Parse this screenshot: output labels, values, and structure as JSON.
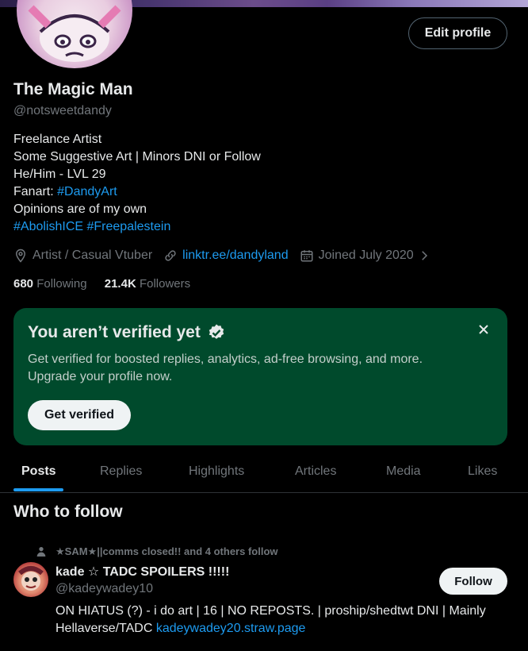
{
  "profile": {
    "edit_label": "Edit profile",
    "name": "The Magic Man",
    "handle": "@notsweetdandy",
    "bio": {
      "line1": "Freelance Artist",
      "line2": "Some Suggestive Art | Minors DNI or Follow",
      "line3": "He/Him - LVL 29",
      "line4_prefix": "Fanart: ",
      "line4_tag": "#DandyArt",
      "line5": "Opinions are of my own",
      "tag1": "#AbolishICE",
      "tag2": "#Freepalestein"
    },
    "location": "Artist / Casual Vtuber",
    "website": "linktr.ee/dandyland",
    "joined": "Joined July 2020",
    "following_count": "680",
    "following_label": "Following",
    "followers_count": "21.4K",
    "followers_label": "Followers"
  },
  "verify": {
    "title": "You aren’t verified yet",
    "description": "Get verified for boosted replies, analytics, ad-free browsing, and more. Upgrade your profile now.",
    "button": "Get verified"
  },
  "tabs": [
    "Posts",
    "Replies",
    "Highlights",
    "Articles",
    "Media",
    "Likes"
  ],
  "active_tab": "Posts",
  "who_to_follow": {
    "title": "Who to follow",
    "social_context": "★SAM★||comms closed!! and 4 others follow",
    "user": {
      "name": "kade ☆ TADC SPOILERS !!!!!",
      "handle": "@kadeywadey10",
      "bio_text": "ON HIATUS (?) - i do art | 16 | NO REPOSTS. | proship/shedtwt DNI | Mainly Hellaverse/TADC ",
      "bio_link": "kadeywadey20.straw.page",
      "follow_label": "Follow"
    }
  },
  "colors": {
    "background": "#000000",
    "text": "#e7e9ea",
    "muted": "#71767b",
    "accent": "#1d9bf0",
    "verify_bg": "#004a2c"
  },
  "icons": [
    "location-icon",
    "link-icon",
    "calendar-icon",
    "chevron-right-icon",
    "verified-badge-icon",
    "close-icon",
    "person-icon"
  ]
}
